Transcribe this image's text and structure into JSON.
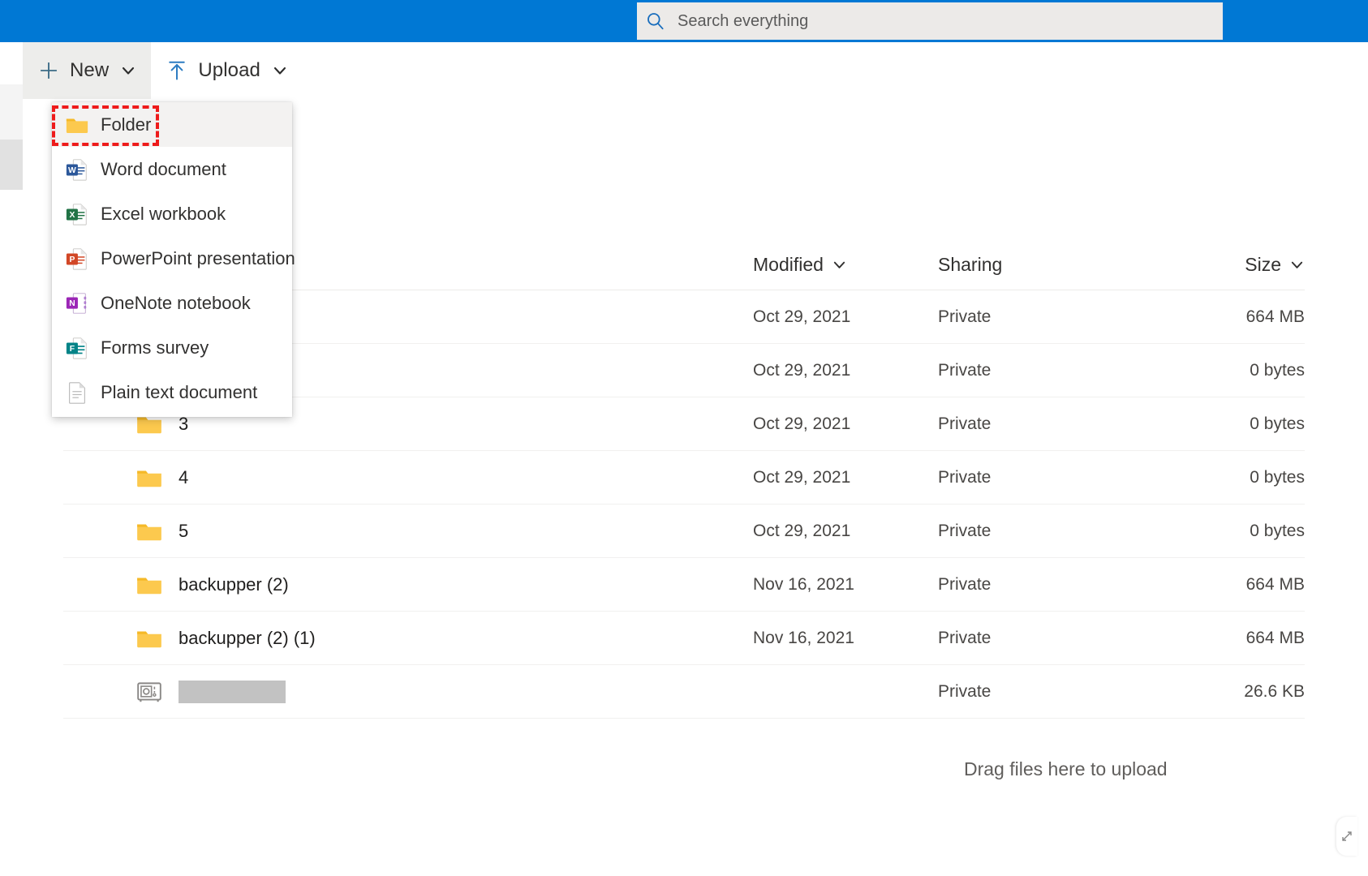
{
  "suitebar": {
    "search": {
      "placeholder": "Search everything",
      "value": "",
      "icon": "search-icon"
    },
    "background_color": "#0078d4"
  },
  "commandbar": {
    "buttons": [
      {
        "label": "New",
        "icon": "plus-icon",
        "caret": "chevron-down-icon",
        "state": "active"
      },
      {
        "label": "Upload",
        "icon": "upload-icon",
        "caret": "chevron-down-icon",
        "state": "default"
      }
    ]
  },
  "new_menu": {
    "highlight_color": "#ee1b1b",
    "items": [
      {
        "label": "Folder",
        "icon": "folder-icon",
        "highlighted": true
      },
      {
        "label": "Word document",
        "icon": "word-document-icon",
        "highlighted": false
      },
      {
        "label": "Excel workbook",
        "icon": "excel-workbook-icon",
        "highlighted": false
      },
      {
        "label": "PowerPoint presentation",
        "icon": "powerpoint-icon",
        "highlighted": false
      },
      {
        "label": "OneNote notebook",
        "icon": "onenote-icon",
        "highlighted": false
      },
      {
        "label": "Forms survey",
        "icon": "forms-survey-icon",
        "highlighted": false
      },
      {
        "label": "Plain text document",
        "icon": "plain-text-document-icon",
        "highlighted": false
      }
    ]
  },
  "filelist": {
    "columns": [
      {
        "key": "name",
        "label": "",
        "sortable": false
      },
      {
        "key": "modified",
        "label": "Modified",
        "sortable": true,
        "caret": "chevron-down-icon"
      },
      {
        "key": "sharing",
        "label": "Sharing",
        "sortable": false
      },
      {
        "key": "size",
        "label": "Size",
        "sortable": true,
        "caret": "chevron-down-icon"
      }
    ],
    "rows": [
      {
        "name": "",
        "icon": "folder-icon",
        "modified": "Oct 29, 2021",
        "sharing": "Private",
        "size": "664 MB",
        "name_redacted": false,
        "name_hidden_by_menu": true
      },
      {
        "name": "",
        "icon": "folder-icon",
        "modified": "Oct 29, 2021",
        "sharing": "Private",
        "size": "0 bytes",
        "name_redacted": false,
        "name_hidden_by_menu": true
      },
      {
        "name": "3",
        "icon": "folder-icon",
        "modified": "Oct 29, 2021",
        "sharing": "Private",
        "size": "0 bytes",
        "name_redacted": false,
        "name_hidden_by_menu": false
      },
      {
        "name": "4",
        "icon": "folder-icon",
        "modified": "Oct 29, 2021",
        "sharing": "Private",
        "size": "0 bytes",
        "name_redacted": false,
        "name_hidden_by_menu": false
      },
      {
        "name": "5",
        "icon": "folder-icon",
        "modified": "Oct 29, 2021",
        "sharing": "Private",
        "size": "0 bytes",
        "name_redacted": false,
        "name_hidden_by_menu": false
      },
      {
        "name": "backupper (2)",
        "icon": "folder-icon",
        "modified": "Nov 16, 2021",
        "sharing": "Private",
        "size": "664 MB",
        "name_redacted": false,
        "name_hidden_by_menu": false
      },
      {
        "name": "backupper (2) (1)",
        "icon": "folder-icon",
        "modified": "Nov 16, 2021",
        "sharing": "Private",
        "size": "664 MB",
        "name_redacted": false,
        "name_hidden_by_menu": false
      },
      {
        "name": "",
        "icon": "personal-vault-icon",
        "modified": "",
        "sharing": "Private",
        "size": "26.6 KB",
        "name_redacted": true,
        "name_hidden_by_menu": false
      }
    ]
  },
  "footer": {
    "drop_hint": "Drag files here to upload"
  }
}
